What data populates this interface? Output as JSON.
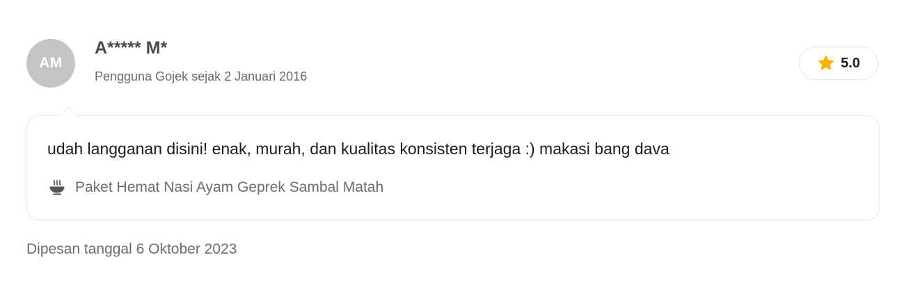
{
  "reviewer": {
    "initials": "AM",
    "name": "A***** M*",
    "member_since": "Pengguna Gojek sejak 2 Januari 2016",
    "avatar_color": "#c4c4c4"
  },
  "rating": {
    "icon": "star-icon",
    "value": "5.0",
    "star_color": "#f5b400"
  },
  "review": {
    "text": "udah langganan disini! enak, murah, dan kualitas konsisten terjaga :) makasi bang dava",
    "dish_icon": "food-bowl-icon",
    "dish": "Paket Hemat Nasi Ayam Geprek Sambal Matah"
  },
  "order": {
    "date_text": "Dipesan tanggal 6 Oktober 2023"
  }
}
